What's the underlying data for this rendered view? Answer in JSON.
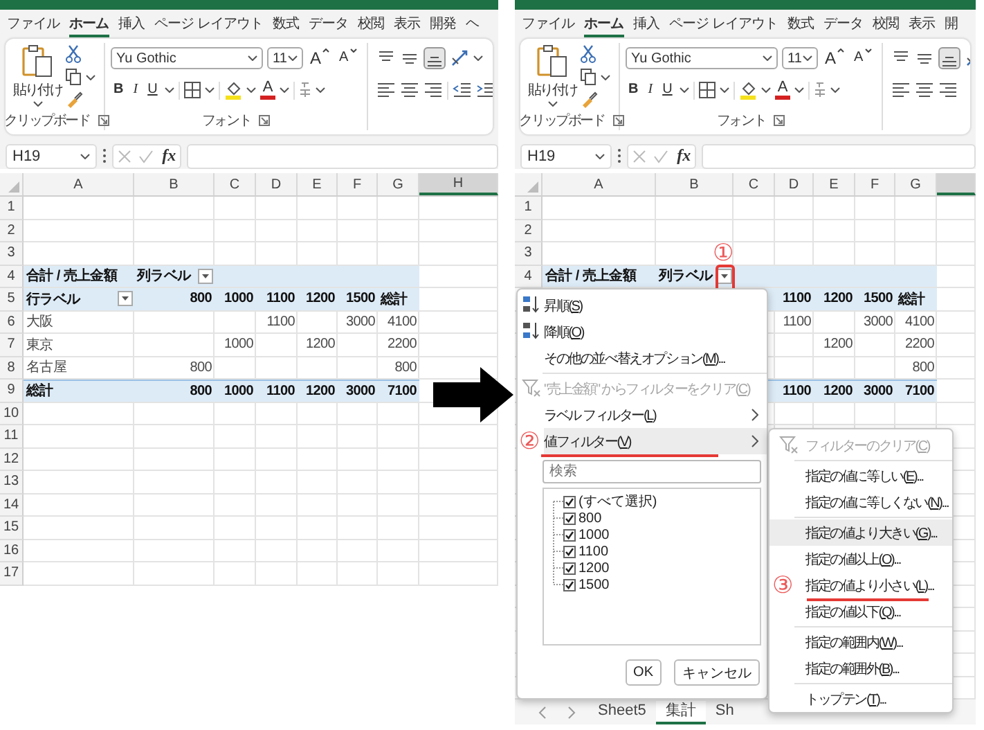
{
  "panels": [
    {
      "tabs": [
        {
          "label": "ファイル",
          "selected": false
        },
        {
          "label": "ホーム",
          "selected": true
        },
        {
          "label": "挿入",
          "selected": false
        },
        {
          "label": "ページ レイアウト",
          "selected": false
        },
        {
          "label": "数式",
          "selected": false
        },
        {
          "label": "データ",
          "selected": false
        },
        {
          "label": "校閲",
          "selected": false
        },
        {
          "label": "表示",
          "selected": false
        },
        {
          "label": "開発",
          "selected": false
        },
        {
          "label": "ヘ",
          "selected": false
        }
      ],
      "ribbon": {
        "paste": "貼り付け",
        "clipboard_group": "クリップボード",
        "font_name": "Yu Gothic",
        "font_size": "11",
        "grow_font": "A",
        "shrink_font": "A",
        "bold": "B",
        "italic": "I",
        "underline": "U",
        "font_color": "A",
        "font_group": "フォント",
        "align_bottom_selected": true
      },
      "name_box": "H19",
      "function_button": "fx",
      "columns": [
        {
          "label": "A",
          "selected": false
        },
        {
          "label": "B",
          "selected": false
        },
        {
          "label": "C",
          "selected": false
        },
        {
          "label": "D",
          "selected": false
        },
        {
          "label": "E",
          "selected": false
        },
        {
          "label": "F",
          "selected": false
        },
        {
          "label": "G",
          "selected": false
        },
        {
          "label": "H",
          "selected": true
        }
      ],
      "rows": [
        {
          "number": "1",
          "kind": "blank"
        },
        {
          "number": "2",
          "kind": "blank"
        },
        {
          "number": "3",
          "kind": "blank"
        },
        {
          "number": "4",
          "kind": "header",
          "cells": [
            {
              "text": "合計 / 売上金額",
              "kind": "label"
            },
            {
              "text": "列ラベル",
              "kind": "label",
              "filter_button": true,
              "highlighted": false
            }
          ]
        },
        {
          "number": "5",
          "kind": "header",
          "cells": [
            {
              "text": "行ラベル",
              "kind": "label",
              "filter_button": true,
              "highlighted": false
            },
            {
              "text": "800",
              "kind": "number"
            },
            {
              "text": "1000",
              "kind": "number"
            },
            {
              "text": "1100",
              "kind": "number"
            },
            {
              "text": "1200",
              "kind": "number"
            },
            {
              "text": "1500",
              "kind": "number"
            },
            {
              "text": "総計",
              "kind": "label"
            }
          ]
        },
        {
          "number": "6",
          "kind": "body",
          "cells": [
            {
              "text": "大阪",
              "kind": "label"
            },
            null,
            null,
            {
              "text": "1100",
              "kind": "number"
            },
            null,
            {
              "text": "3000",
              "kind": "number"
            },
            {
              "text": "4100",
              "kind": "number"
            }
          ]
        },
        {
          "number": "7",
          "kind": "body",
          "cells": [
            {
              "text": "東京",
              "kind": "label"
            },
            null,
            {
              "text": "1000",
              "kind": "number"
            },
            null,
            {
              "text": "1200",
              "kind": "number"
            },
            null,
            {
              "text": "2200",
              "kind": "number"
            }
          ]
        },
        {
          "number": "8",
          "kind": "body",
          "cells": [
            {
              "text": "名古屋",
              "kind": "label"
            },
            {
              "text": "800",
              "kind": "number"
            },
            null,
            null,
            null,
            null,
            {
              "text": "800",
              "kind": "number"
            }
          ]
        },
        {
          "number": "9",
          "kind": "total",
          "cells": [
            {
              "text": "総計",
              "kind": "label"
            },
            {
              "text": "800",
              "kind": "number"
            },
            {
              "text": "1000",
              "kind": "number"
            },
            {
              "text": "1100",
              "kind": "number"
            },
            {
              "text": "1200",
              "kind": "number"
            },
            {
              "text": "3000",
              "kind": "number"
            },
            {
              "text": "7100",
              "kind": "number"
            }
          ]
        },
        {
          "number": "10",
          "kind": "blank"
        },
        {
          "number": "11",
          "kind": "blank"
        },
        {
          "number": "12",
          "kind": "blank"
        },
        {
          "number": "13",
          "kind": "blank"
        },
        {
          "number": "14",
          "kind": "blank"
        },
        {
          "number": "15",
          "kind": "blank"
        },
        {
          "number": "16",
          "kind": "blank"
        },
        {
          "number": "17",
          "kind": "blank"
        }
      ]
    },
    {
      "tabs": [
        {
          "label": "ファイル",
          "selected": false
        },
        {
          "label": "ホーム",
          "selected": true
        },
        {
          "label": "挿入",
          "selected": false
        },
        {
          "label": "ページ レイアウト",
          "selected": false
        },
        {
          "label": "数式",
          "selected": false
        },
        {
          "label": "データ",
          "selected": false
        },
        {
          "label": "校閲",
          "selected": false
        },
        {
          "label": "表示",
          "selected": false
        },
        {
          "label": "開",
          "selected": false
        }
      ],
      "ribbon": {
        "paste": "貼り付け",
        "clipboard_group": "クリップボード",
        "font_name": "Yu Gothic",
        "font_size": "11",
        "grow_font": "A",
        "shrink_font": "A",
        "bold": "B",
        "italic": "I",
        "underline": "U",
        "font_color": "A",
        "font_group": "フォント",
        "align_bottom_selected": true
      },
      "name_box": "H19",
      "function_button": "fx",
      "columns": [
        {
          "label": "A",
          "selected": false
        },
        {
          "label": "B",
          "selected": false
        },
        {
          "label": "C",
          "selected": false
        },
        {
          "label": "D",
          "selected": false
        },
        {
          "label": "E",
          "selected": false
        },
        {
          "label": "F",
          "selected": false
        },
        {
          "label": "G",
          "selected": false
        },
        {
          "selected": true
        }
      ],
      "rows": [
        {
          "number": "1",
          "kind": "blank"
        },
        {
          "number": "2",
          "kind": "blank"
        },
        {
          "number": "3",
          "kind": "blank"
        },
        {
          "number": "4",
          "kind": "header",
          "cells": [
            {
              "text": "合計 / 売上金額",
              "kind": "label"
            },
            {
              "text": "列ラベル",
              "kind": "label",
              "filter_button": true,
              "highlighted": true,
              "annotation": "①"
            }
          ]
        },
        {
          "kind": "header",
          "cells": [
            null,
            null,
            null,
            {
              "text": "1100",
              "kind": "number"
            },
            {
              "text": "1200",
              "kind": "number"
            },
            {
              "text": "1500",
              "kind": "number"
            },
            {
              "text": "総計",
              "kind": "label"
            }
          ]
        },
        {
          "kind": "body",
          "cells": [
            null,
            null,
            null,
            {
              "text": "1100",
              "kind": "number"
            },
            null,
            {
              "text": "3000",
              "kind": "number"
            },
            {
              "text": "4100",
              "kind": "number"
            }
          ]
        },
        {
          "kind": "body",
          "cells": [
            null,
            null,
            null,
            null,
            {
              "text": "1200",
              "kind": "number"
            },
            null,
            {
              "text": "2200",
              "kind": "number"
            }
          ]
        },
        {
          "kind": "body",
          "cells": [
            null,
            null,
            null,
            null,
            null,
            null,
            {
              "text": "800",
              "kind": "number"
            }
          ]
        },
        {
          "kind": "total",
          "cells": [
            null,
            null,
            null,
            {
              "text": "1100",
              "kind": "number"
            },
            {
              "text": "1200",
              "kind": "number"
            },
            {
              "text": "3000",
              "kind": "number"
            },
            {
              "text": "7100",
              "kind": "number"
            }
          ]
        },
        {
          "kind": "blank"
        },
        {
          "kind": "blank"
        },
        {
          "kind": "blank"
        },
        {
          "kind": "blank"
        },
        {
          "kind": "blank"
        },
        {
          "kind": "blank"
        },
        {
          "kind": "blank"
        },
        {
          "kind": "blank"
        },
        {
          "kind": "blank"
        },
        {
          "kind": "blank"
        },
        {
          "kind": "blank"
        },
        {
          "kind": "blank"
        },
        {
          "kind": "blank"
        }
      ],
      "filter_menu": {
        "items": [
          {
            "kind": "sort_ascending",
            "text": "昇順(",
            "access_key": "S",
            "after": ")",
            "selected": false,
            "disabled": false
          },
          {
            "kind": "sort_descending",
            "text": "降順(",
            "access_key": "O",
            "after": ")",
            "selected": false,
            "disabled": false
          },
          {
            "kind": "command",
            "text": "その他の並べ替えオプション(",
            "access_key": "M",
            "after": ")...",
            "selected": false,
            "disabled": false
          },
          {
            "kind": "separator"
          },
          {
            "kind": "clear_filter",
            "text": "\"売上金額\" からフィルターをクリア(",
            "access_key": "C",
            "after": ")",
            "selected": false,
            "disabled": true
          },
          {
            "kind": "submenu",
            "text": "ラベル フィルター(",
            "access_key": "L",
            "after": ")",
            "selected": false,
            "disabled": false
          },
          {
            "kind": "submenu",
            "text": "値フィルター(",
            "access_key": "V",
            "after": ")",
            "selected": true,
            "disabled": false,
            "annotation": "②"
          }
        ],
        "search_placeholder": "検索",
        "values": [
          {
            "label": "(すべて選択)",
            "checked": true
          },
          {
            "label": "800",
            "checked": true
          },
          {
            "label": "1000",
            "checked": true
          },
          {
            "label": "1100",
            "checked": true
          },
          {
            "label": "1200",
            "checked": true
          },
          {
            "label": "1500",
            "checked": true
          }
        ],
        "buttons": [
          "OK",
          "キャンセル"
        ],
        "submenu": [
          {
            "kind": "clear_filter",
            "text": "フィルターのクリア(",
            "access_key": "C",
            "after": ")",
            "selected": false,
            "disabled": true
          },
          {
            "kind": "separator"
          },
          {
            "kind": "command",
            "text": "指定の値に等しい(",
            "access_key": "E",
            "after": ")...",
            "selected": false,
            "disabled": false
          },
          {
            "kind": "command",
            "text": "指定の値に等しくない(",
            "access_key": "N",
            "after": ")...",
            "selected": false,
            "disabled": false
          },
          {
            "kind": "separator"
          },
          {
            "kind": "command",
            "text": "指定の値より大きい(",
            "access_key": "G",
            "after": ")...",
            "selected": true,
            "disabled": false
          },
          {
            "kind": "command",
            "text": "指定の値以上(",
            "access_key": "O",
            "after": ")...",
            "selected": false,
            "disabled": false
          },
          {
            "kind": "command",
            "text": "指定の値より小さい(",
            "access_key": "L",
            "after": ")...",
            "selected": false,
            "disabled": false,
            "annotation": "③"
          },
          {
            "kind": "command",
            "text": "指定の値以下(",
            "access_key": "Q",
            "after": ")...",
            "selected": false,
            "disabled": false
          },
          {
            "kind": "separator"
          },
          {
            "kind": "command",
            "text": "指定の範囲内(",
            "access_key": "W",
            "after": ")...",
            "selected": false,
            "disabled": false
          },
          {
            "kind": "command",
            "text": "指定の範囲外(",
            "access_key": "B",
            "after": ")...",
            "selected": false,
            "disabled": false
          },
          {
            "kind": "separator"
          },
          {
            "kind": "command",
            "text": "トップテン(",
            "access_key": "T",
            "after": ")...",
            "selected": false,
            "disabled": false
          }
        ]
      },
      "sheet_tabs": [
        {
          "label": "Sheet5",
          "selected": false
        },
        {
          "label": "集計",
          "selected": true
        },
        {
          "label": "Sh",
          "selected": false
        }
      ]
    }
  ]
}
